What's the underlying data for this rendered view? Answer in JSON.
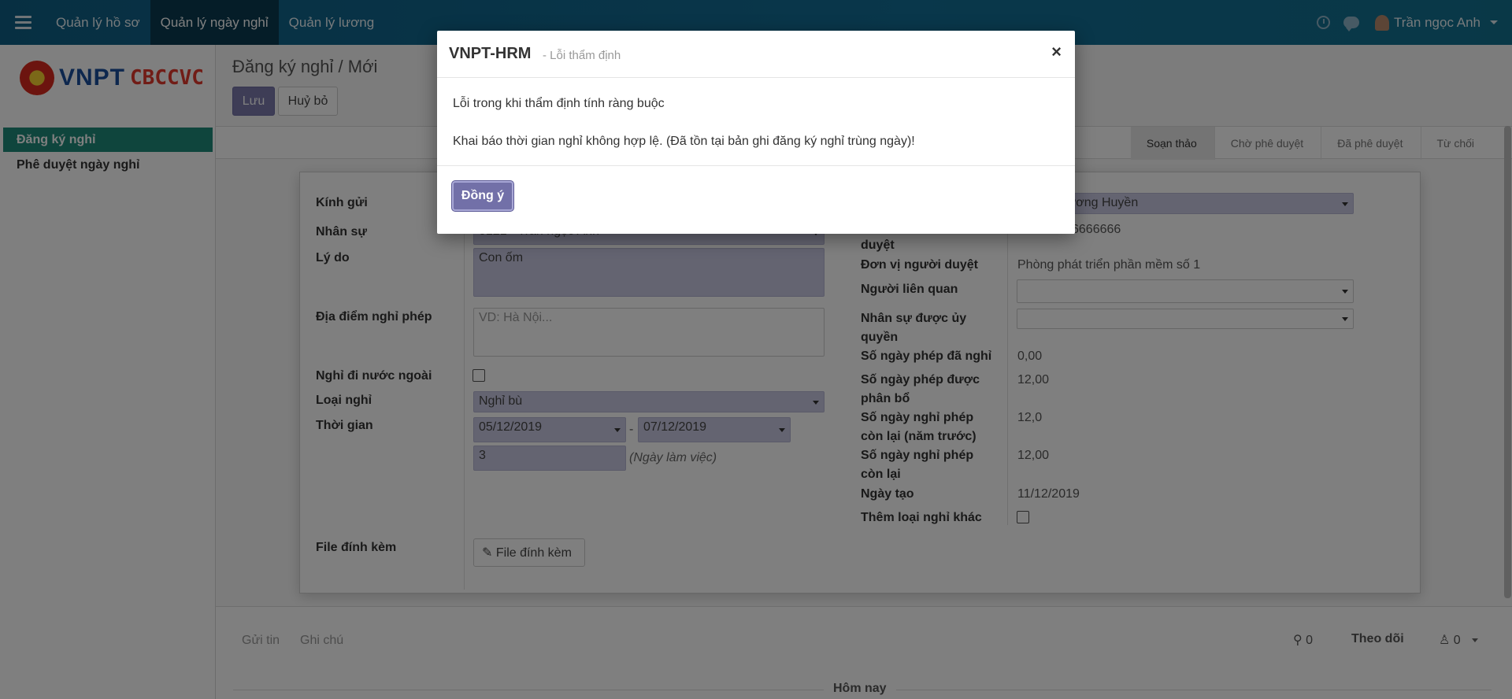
{
  "topnav": {
    "items": [
      {
        "label": "Quản lý hồ sơ",
        "active": false
      },
      {
        "label": "Quản lý ngày nghỉ",
        "active": true
      },
      {
        "label": "Quản lý lương",
        "active": false
      }
    ],
    "user_name": "Trần ngọc Anh",
    "icons": [
      "menu-icon",
      "clock-icon",
      "chat-icon",
      "user-avatar-icon"
    ]
  },
  "sidebar": {
    "logo_text": "VNPT",
    "logo_sub": "CBCCVC",
    "items": [
      {
        "label": "Đăng ký nghỉ",
        "active": true
      },
      {
        "label": "Phê duyệt ngày nghỉ",
        "active": false
      }
    ]
  },
  "header": {
    "breadcrumb": "Đăng ký nghỉ / Mới",
    "save_label": "Lưu",
    "discard_label": "Huỷ bỏ"
  },
  "status": {
    "steps": [
      "Soạn thảo",
      "Chờ phê duyệt",
      "Đã phê duyệt",
      "Từ chối"
    ],
    "active_index": 0
  },
  "form": {
    "left": {
      "kinh_gui_label": "Kính gửi",
      "nhan_su_label": "Nhân sự",
      "nhan_su_value": "0121 - Trần ngọc Anh",
      "ly_do_label": "Lý do",
      "ly_do_value": "Con ốm",
      "dia_diem_label": "Địa điểm nghỉ phép",
      "dia_diem_placeholder": "VD: Hà Nội...",
      "nuoc_ngoai_label": "Nghỉ đi nước ngoài",
      "loai_nghi_label": "Loại nghỉ",
      "loai_nghi_value": "Nghỉ bù",
      "thoi_gian_label": "Thời gian",
      "date_from": "05/12/2019",
      "date_sep": "-",
      "date_to": "07/12/2019",
      "so_ngay": "3",
      "so_ngay_hint": "(Ngày làm việc)",
      "file_label": "File đính kèm",
      "file_button": "File đính kèm"
    },
    "right": {
      "nguoi_duyet_value": "ần Thị Lương Huyền",
      "sdt_label_tail": "duyệt",
      "sdt_value": "6666666",
      "don_vi_label": "Đơn vị người duyệt",
      "don_vi_value": "Phòng phát triển phần mềm số 1",
      "lien_quan_label": "Người liên quan",
      "uy_quyen_label_1": "Nhân sự được ủy",
      "uy_quyen_label_2": "quyền",
      "da_nghi_label": "Số ngày phép đã nghỉ",
      "da_nghi_value": "0,00",
      "phan_bo_label_1": "Số ngày phép được",
      "phan_bo_label_2": "phân bổ",
      "phan_bo_value": "12,00",
      "con_lai_truoc_label_1": "Số ngày nghỉ phép",
      "con_lai_truoc_label_2": "còn lại (năm trước)",
      "con_lai_truoc_value": "12,0",
      "con_lai_label_1": "Số ngày nghỉ phép",
      "con_lai_label_2": "còn lại",
      "con_lai_value": "12,00",
      "ngay_tao_label": "Ngày tạo",
      "ngay_tao_value": "11/12/2019",
      "them_loai_label": "Thêm loại nghỉ khác"
    }
  },
  "chatter": {
    "send_message": "Gửi tin",
    "log_note": "Ghi chú",
    "attachments_count": "0",
    "follow_label": "Theo dõi",
    "followers_count": "0",
    "today_label": "Hôm nay"
  },
  "modal": {
    "title": "VNPT-HRM",
    "subtitle": "- Lỗi thẩm định",
    "close_glyph": "×",
    "line1": "Lỗi trong khi thẩm định tính ràng buộc",
    "line2": "Khai báo thời gian nghỉ không hợp lệ. (Đã tồn tại bản ghi đăng ký nghỉ trùng ngày)!",
    "ok_label": "Đồng ý"
  },
  "colors": {
    "topbar": "#0f5f85",
    "primary_button": "#7c7bad",
    "sidebar_active": "#1e8a7a",
    "required_field": "#c9c9e3"
  }
}
